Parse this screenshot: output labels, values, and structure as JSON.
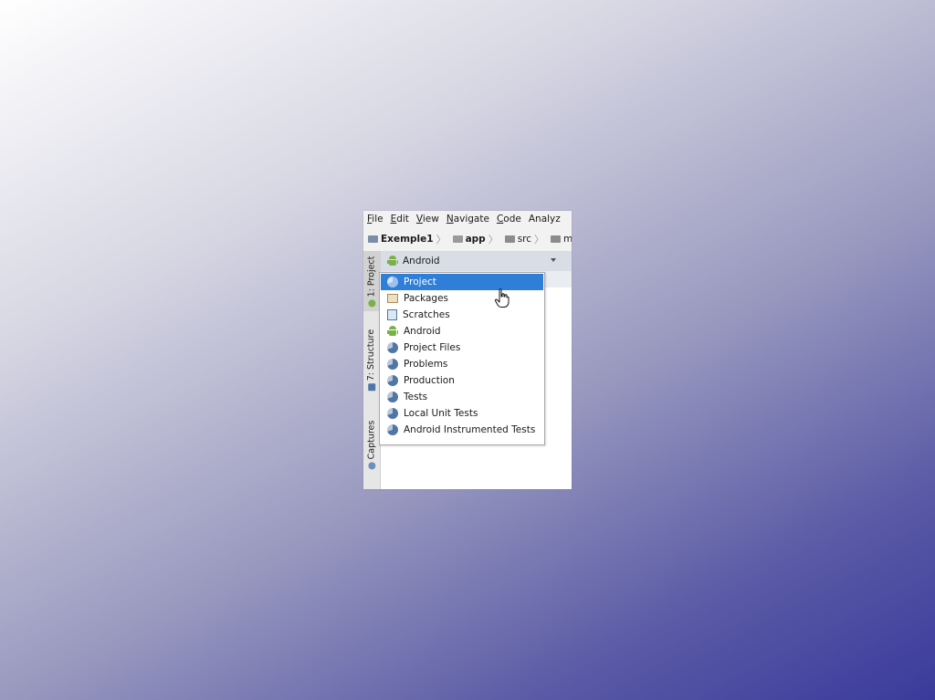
{
  "menubar": {
    "items": [
      {
        "first": "F",
        "rest": "ile"
      },
      {
        "first": "E",
        "rest": "dit"
      },
      {
        "first": "V",
        "rest": "iew"
      },
      {
        "first": "N",
        "rest": "avigate"
      },
      {
        "first": "C",
        "rest": "ode"
      },
      {
        "first": "",
        "rest": "Analyz"
      }
    ]
  },
  "breadcrumb": {
    "items": [
      "Exemple1",
      "app",
      "src",
      "main"
    ]
  },
  "toolwindows": {
    "project": "1: Project",
    "structure": "7: Structure",
    "captures": "Captures"
  },
  "project_pane": {
    "view_selector": "Android"
  },
  "dropdown": {
    "selected_index": 0,
    "options": [
      {
        "label": "Project",
        "icon": "project-view-icon"
      },
      {
        "label": "Packages",
        "icon": "packages-icon"
      },
      {
        "label": "Scratches",
        "icon": "scratches-icon"
      },
      {
        "label": "Android",
        "icon": "android-icon"
      },
      {
        "label": "Project Files",
        "icon": "project-view-icon"
      },
      {
        "label": "Problems",
        "icon": "project-view-icon"
      },
      {
        "label": "Production",
        "icon": "project-view-icon"
      },
      {
        "label": "Tests",
        "icon": "project-view-icon"
      },
      {
        "label": "Local Unit Tests",
        "icon": "project-view-icon"
      },
      {
        "label": "Android Instrumented Tests",
        "icon": "project-view-icon"
      }
    ]
  },
  "colors": {
    "selection": "#2f7ed8",
    "android_green": "#78b144",
    "background_gradient_end": "#3a3a9c"
  }
}
